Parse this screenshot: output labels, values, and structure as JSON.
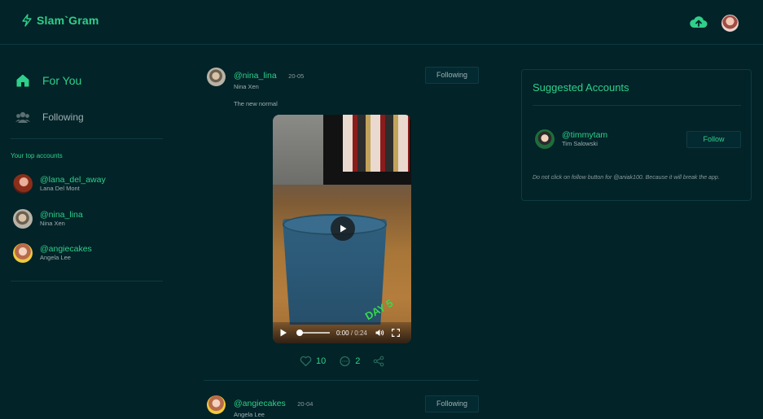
{
  "app": {
    "title": "Slam`Gram",
    "accent": "#2fd08a",
    "background": "#022328"
  },
  "header": {
    "upload_icon": "cloud-upload-icon",
    "avatar": "user-avatar"
  },
  "sidebar": {
    "items": [
      {
        "label": "For You",
        "icon": "home-icon",
        "active": true
      },
      {
        "label": "Following",
        "icon": "users-icon",
        "active": false
      }
    ],
    "top_accounts_title": "Your top accounts",
    "top_accounts": [
      {
        "handle": "@lana_del_away",
        "name": "Lana Del Mont"
      },
      {
        "handle": "@nina_lina",
        "name": "Nina Xen"
      },
      {
        "handle": "@angiecakes",
        "name": "Angela Lee"
      }
    ]
  },
  "feed": {
    "posts": [
      {
        "handle": "@nina_lina",
        "date": "20-05",
        "name": "Nina Xen",
        "follow_label": "Following",
        "caption": "The new normal",
        "video": {
          "time_current": "0:00",
          "time_total": "0:24",
          "overlay_text": "DAY 5"
        },
        "likes": "10",
        "comments": "2"
      },
      {
        "handle": "@angiecakes",
        "date": "20-04",
        "name": "Angela Lee",
        "follow_label": "Following"
      }
    ]
  },
  "suggested": {
    "title": "Suggested Accounts",
    "accounts": [
      {
        "handle": "@timmytam",
        "name": "Tim Salowski",
        "button": "Follow"
      }
    ],
    "note": "Do not click on follow button for @aniak100. Because it will break the app."
  }
}
